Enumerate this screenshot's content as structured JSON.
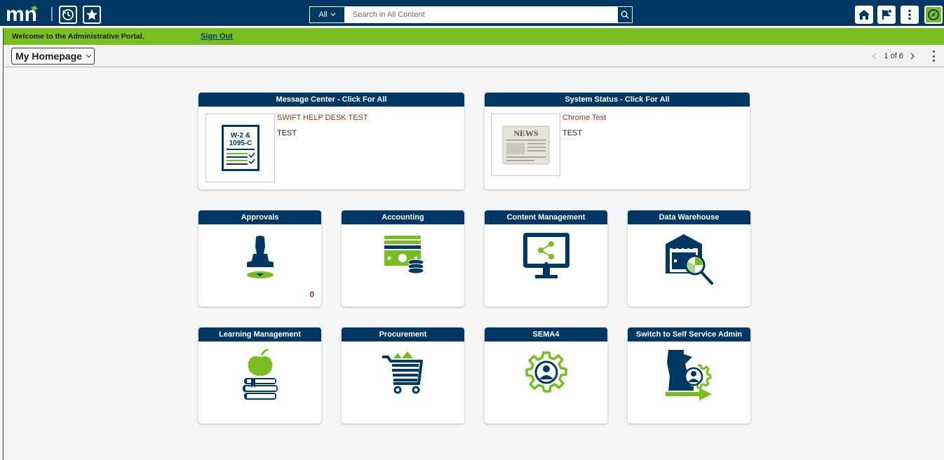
{
  "header": {
    "logo_text": "mn",
    "search": {
      "scope": "All",
      "placeholder": "Search in All Content"
    }
  },
  "welcome": {
    "text": "Welcome to the Administrative Portal,",
    "sign_out": "Sign Out"
  },
  "homebar": {
    "homepage": "My Homepage",
    "page_indicator": "1 of 6"
  },
  "tiles": {
    "message_center": {
      "title": "Message Center - Click For All",
      "image_text_line1": "W-2 &",
      "image_text_line2": "1095-C",
      "item_title": "SWIFT HELP DESK TEST",
      "item_body": "TEST"
    },
    "system_status": {
      "title": "System Status - Click For All",
      "image_text": "NEWS",
      "item_title": "Chrome Test",
      "item_body": "TEST"
    },
    "approvals": {
      "title": "Approvals",
      "count": "0"
    },
    "accounting": {
      "title": "Accounting"
    },
    "content_management": {
      "title": "Content Management"
    },
    "data_warehouse": {
      "title": "Data Warehouse"
    },
    "learning_management": {
      "title": "Learning Management"
    },
    "procurement": {
      "title": "Procurement"
    },
    "sema4": {
      "title": "SEMA4"
    },
    "self_service_admin": {
      "title": "Switch to Self Service Admin"
    }
  },
  "colors": {
    "navy": "#003865",
    "green": "#78be20",
    "link_brown": "#8b3a1e"
  },
  "icons": {
    "recent": "clock-icon",
    "favorites": "star-icon",
    "home": "home-icon",
    "notifications": "flag-icon",
    "actions": "kebab-icon",
    "navbar": "compass-icon"
  }
}
